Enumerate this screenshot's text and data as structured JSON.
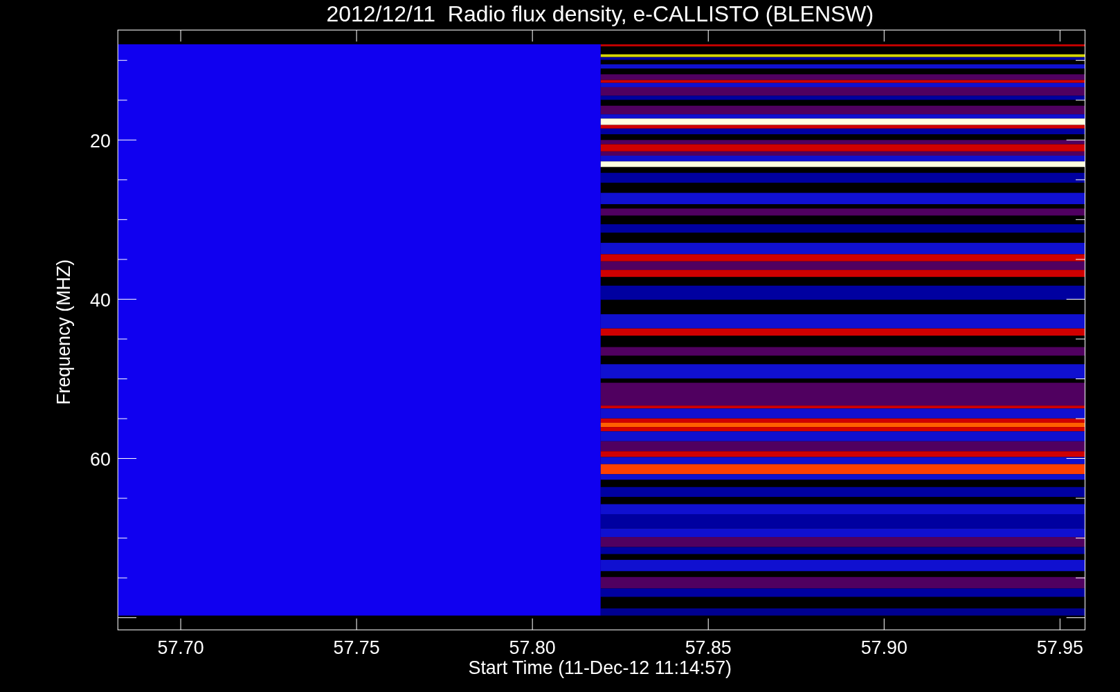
{
  "title": "2012/12/11  Radio flux density, e-CALLISTO (BLENSW)",
  "y_axis": {
    "label": "Frequency (MHZ)",
    "ticks": [
      "20",
      "40",
      "60"
    ]
  },
  "x_axis": {
    "label": "Start Time (11-Dec-12 11:14:57)",
    "ticks": [
      "57.70",
      "57.75",
      "57.80",
      "57.85",
      "57.90",
      "57.95"
    ]
  }
}
